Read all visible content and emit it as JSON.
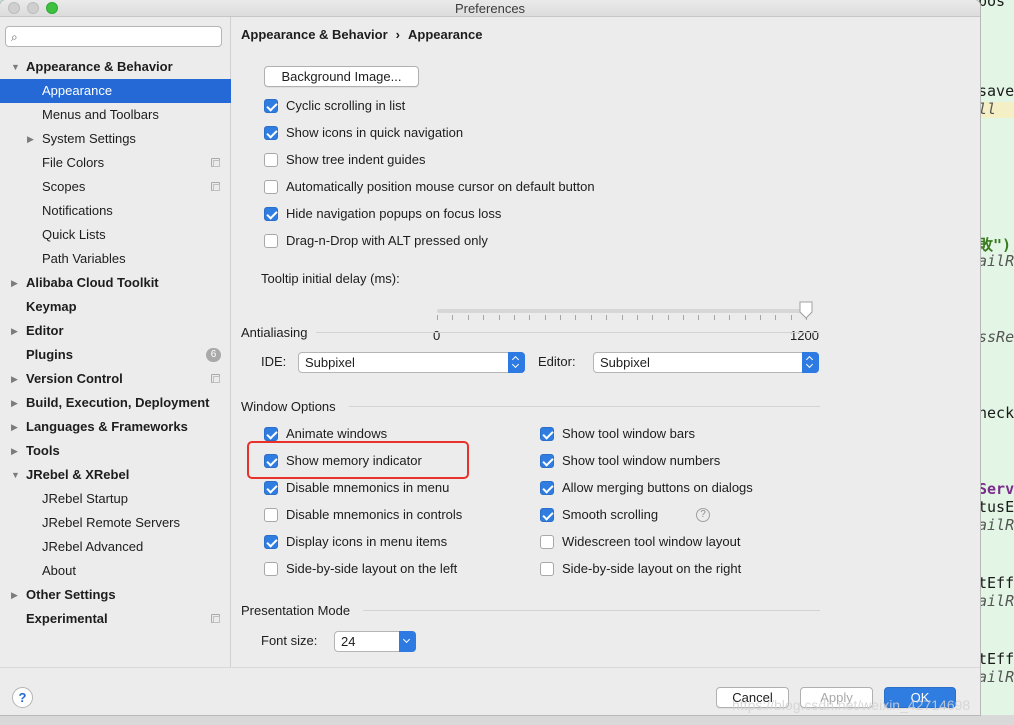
{
  "window": {
    "title": "Preferences"
  },
  "search": {
    "placeholder": "",
    "value": ""
  },
  "sidebar": {
    "items": [
      {
        "label": "Appearance & Behavior",
        "bold": true,
        "arrow": "down"
      },
      {
        "label": "Appearance",
        "selected": true
      },
      {
        "label": "Menus and Toolbars"
      },
      {
        "label": "System Settings",
        "arrow": "right"
      },
      {
        "label": "File Colors",
        "icon": "copy-icon"
      },
      {
        "label": "Scopes",
        "icon": "copy-icon"
      },
      {
        "label": "Notifications"
      },
      {
        "label": "Quick Lists"
      },
      {
        "label": "Path Variables"
      },
      {
        "label": "Alibaba Cloud Toolkit",
        "bold": true,
        "arrow": "right"
      },
      {
        "label": "Keymap",
        "bold": true
      },
      {
        "label": "Editor",
        "bold": true,
        "arrow": "right"
      },
      {
        "label": "Plugins",
        "bold": true,
        "badge": "6"
      },
      {
        "label": "Version Control",
        "bold": true,
        "arrow": "right",
        "icon": "copy-icon"
      },
      {
        "label": "Build, Execution, Deployment",
        "bold": true,
        "arrow": "right"
      },
      {
        "label": "Languages & Frameworks",
        "bold": true,
        "arrow": "right"
      },
      {
        "label": "Tools",
        "bold": true,
        "arrow": "right"
      },
      {
        "label": "JRebel & XRebel",
        "bold": true,
        "arrow": "down"
      },
      {
        "label": "JRebel Startup"
      },
      {
        "label": "JRebel Remote Servers"
      },
      {
        "label": "JRebel Advanced"
      },
      {
        "label": "About"
      },
      {
        "label": "Other Settings",
        "bold": true,
        "arrow": "right"
      },
      {
        "label": "Experimental",
        "bold": true,
        "icon": "copy-icon"
      }
    ]
  },
  "breadcrumb": {
    "parent": "Appearance & Behavior",
    "separator": "›",
    "current": "Appearance"
  },
  "ui_options": {
    "background_image_button": "Background Image...",
    "checkboxes": [
      {
        "label": "Cyclic scrolling in list",
        "checked": true
      },
      {
        "label": "Show icons in quick navigation",
        "checked": true
      },
      {
        "label": "Show tree indent guides",
        "checked": false
      },
      {
        "label": "Automatically position mouse cursor on default button",
        "checked": false
      },
      {
        "label": "Hide navigation popups on focus loss",
        "checked": true
      },
      {
        "label": "Drag-n-Drop with ALT pressed only",
        "checked": false
      }
    ],
    "tooltip_delay": {
      "label": "Tooltip initial delay (ms):",
      "min": "0",
      "max": "1200",
      "value": 1200
    }
  },
  "antialiasing": {
    "title": "Antialiasing",
    "ide_label": "IDE:",
    "ide_value": "Subpixel",
    "editor_label": "Editor:",
    "editor_value": "Subpixel"
  },
  "window_options": {
    "title": "Window Options",
    "left": [
      {
        "label": "Animate windows",
        "checked": true
      },
      {
        "label": "Show memory indicator",
        "checked": true
      },
      {
        "label": "Disable mnemonics in menu",
        "checked": true
      },
      {
        "label": "Disable mnemonics in controls",
        "checked": false
      },
      {
        "label": "Display icons in menu items",
        "checked": true
      },
      {
        "label": "Side-by-side layout on the left",
        "checked": false
      }
    ],
    "right": [
      {
        "label": "Show tool window bars",
        "checked": true
      },
      {
        "label": "Show tool window numbers",
        "checked": true
      },
      {
        "label": "Allow merging buttons on dialogs",
        "checked": true
      },
      {
        "label": "Smooth scrolling",
        "checked": true,
        "help": "?"
      },
      {
        "label": "Widescreen tool window layout",
        "checked": false
      },
      {
        "label": "Side-by-side layout on the right",
        "checked": false
      }
    ]
  },
  "presentation_mode": {
    "title": "Presentation Mode",
    "font_size_label": "Font size:",
    "font_size_value": "24"
  },
  "footer": {
    "help": "?",
    "cancel": "Cancel",
    "apply": "Apply",
    "ok": "OK"
  },
  "background_editor": {
    "lines": [
      "pos",
      "save",
      "ll",
      "敗\");",
      "ailR",
      "ssRe",
      "heck",
      "Serv",
      "tusE",
      "ailR",
      "tEff",
      "ailR",
      "tEff",
      "ailR"
    ]
  },
  "watermark": "https://blog.csdn.net/weixin_42714698",
  "colors": {
    "accent": "#2f7de1",
    "selection": "#2469d5",
    "highlight": "#e8312b"
  }
}
